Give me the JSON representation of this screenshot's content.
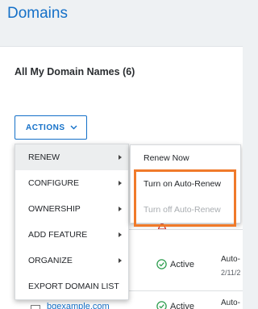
{
  "header": {
    "title": "Domains"
  },
  "card": {
    "title": "All My Domain Names (6)"
  },
  "actions": {
    "label": "ACTIONS"
  },
  "menu": {
    "items": [
      {
        "label": "RENEW",
        "has_submenu": true,
        "active": true
      },
      {
        "label": "CONFIGURE",
        "has_submenu": true
      },
      {
        "label": "OWNERSHIP",
        "has_submenu": true
      },
      {
        "label": "ADD FEATURE",
        "has_submenu": true
      },
      {
        "label": "ORGANIZE",
        "has_submenu": true
      },
      {
        "label": "EXPORT DOMAIN LIST",
        "has_submenu": false
      }
    ]
  },
  "submenu": {
    "items": [
      {
        "label": "Renew Now",
        "disabled": false
      },
      {
        "label": "Turn on Auto-Renew",
        "disabled": false
      },
      {
        "label": "Turn off Auto-Renew",
        "disabled": true
      }
    ]
  },
  "table": {
    "rows": [
      {
        "status": "Active",
        "auto": "Auto-",
        "date": "2/11/2"
      },
      {
        "status": "Active",
        "auto": "Auto-"
      }
    ],
    "partial_link": "bgexample.com"
  },
  "colors": {
    "accent": "#1470c8",
    "highlight": "#f07a2a",
    "status_ok": "#2e9e4f"
  }
}
